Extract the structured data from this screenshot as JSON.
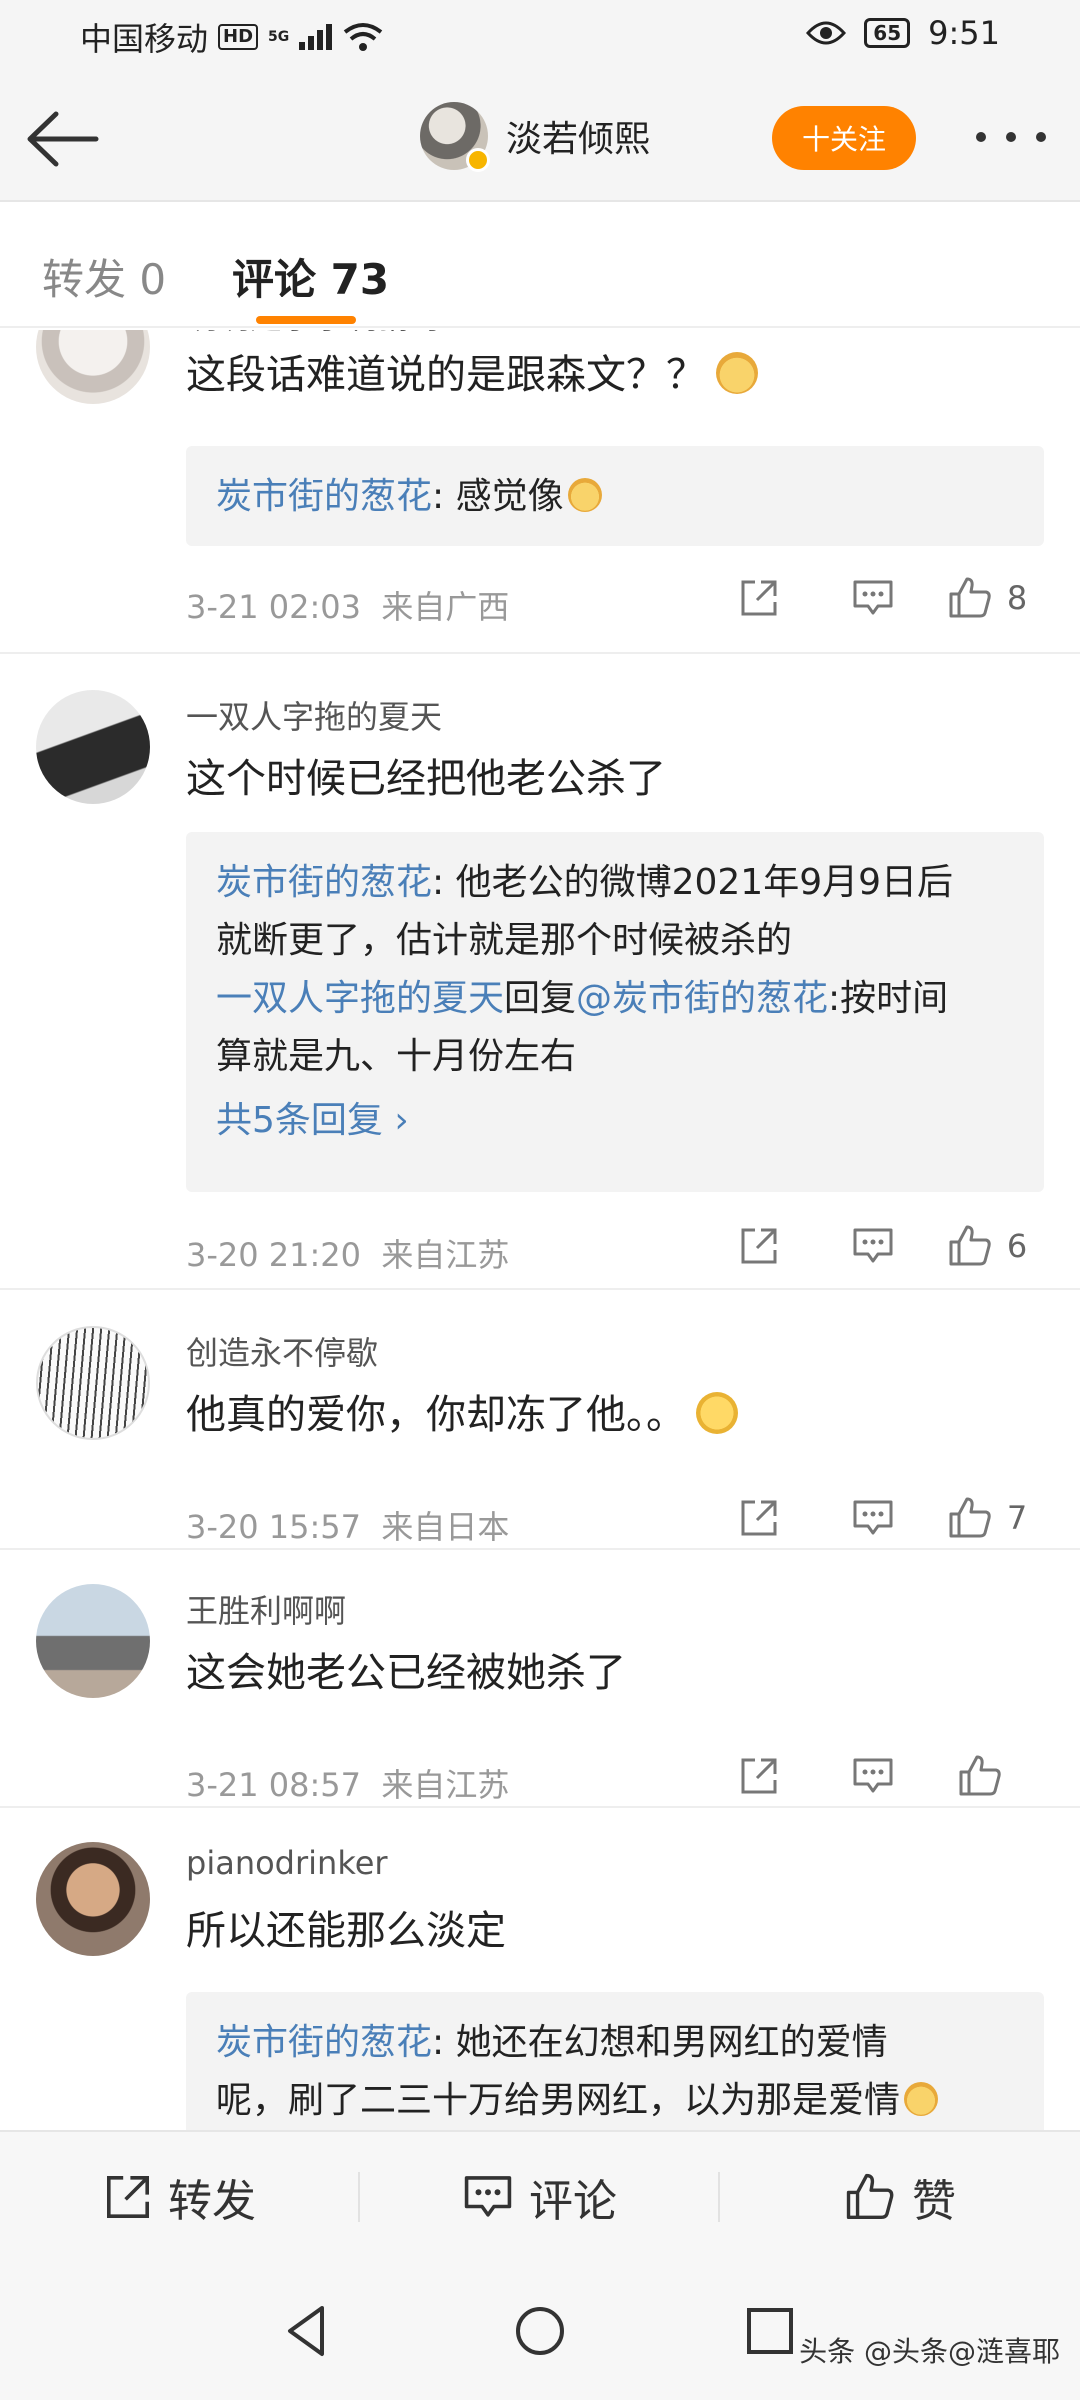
{
  "status_bar": {
    "carrier": "中国移动",
    "hd": "HD",
    "signal": "5G",
    "battery": "65",
    "time": "9:51"
  },
  "header": {
    "username": "淡若倾熙",
    "follow_label": "十关注"
  },
  "tabs": {
    "repost_label": "转发 0",
    "comments_label": "评论 73"
  },
  "comments": [
    {
      "username": "明明是小小刺猬呀",
      "text": "这段话难道说的是跟森文？？",
      "reply_user": "炭市街的葱花",
      "reply_text": ": 感觉像",
      "time": "3-21 02:03",
      "location": "来自广西",
      "likes": "8"
    },
    {
      "username": "一双人字拖的夏天",
      "text": "这个时候已经把他老公杀了",
      "reply_user": "炭市街的葱花",
      "reply_text_line1": ": 他老公的微博2021年9月9日后",
      "reply_text_line2": "就断更了，估计就是那个时候被杀的",
      "reply2_user": "一双人字拖的夏天",
      "reply2_mid": "回复",
      "reply2_at": "@炭市街的葱花",
      "reply2_text_line1": ":按时间",
      "reply2_text_line2": "算就是九、十月份左右",
      "more_replies": "共5条回复 ›",
      "time": "3-20 21:20",
      "location": "来自江苏",
      "likes": "6"
    },
    {
      "username": "创造永不停歇",
      "text": "他真的爱你，你却冻了他。。",
      "time": "3-20 15:57",
      "location": "来自日本",
      "likes": "7"
    },
    {
      "username": "王胜利啊啊",
      "text": "这会她老公已经被她杀了",
      "time": "3-21 08:57",
      "location": "来自江苏",
      "likes": ""
    },
    {
      "username": "pianodrinker",
      "text": "所以还能那么淡定",
      "reply_user": "炭市街的葱花",
      "reply_text_line1": ": 她还在幻想和男网红的爱情",
      "reply_text_line2": "呢，刷了二三十万给男网红，以为那是爱情"
    }
  ],
  "bottom_bar": {
    "repost": "转发",
    "comment": "评论",
    "like": "赞"
  },
  "watermark": "头条 @头条@涟喜耶",
  "colors": {
    "accent": "#ff8200",
    "link": "#4a7fb8",
    "reply_bg": "#f3f3f3"
  }
}
